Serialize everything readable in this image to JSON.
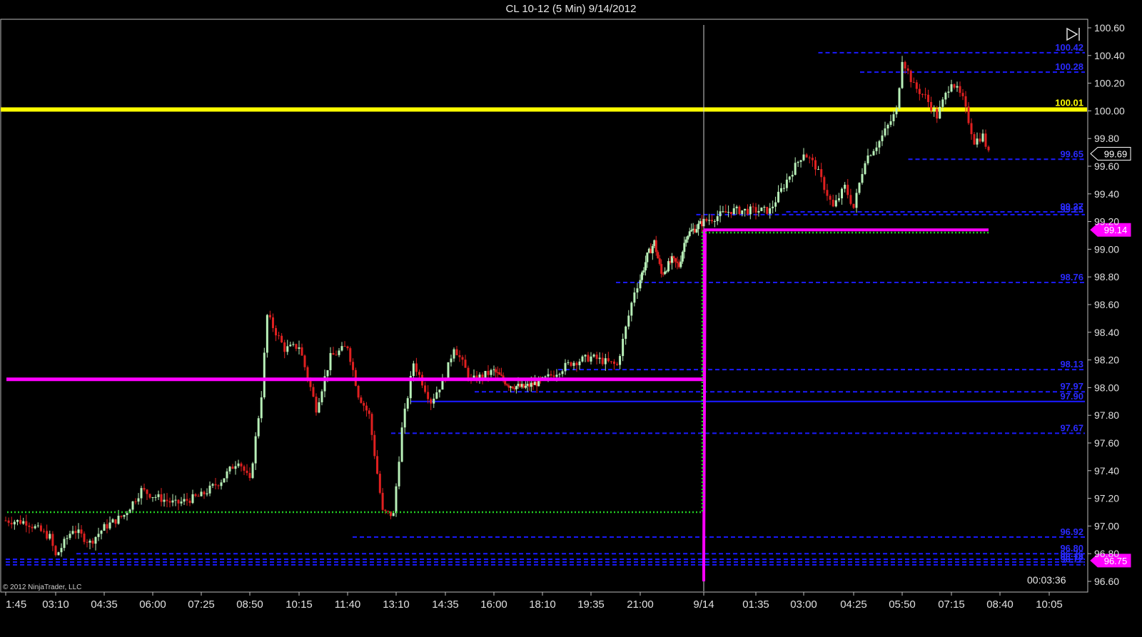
{
  "title": "CL 10-12 (5 Min)  9/14/2012",
  "copyright": "© 2012 NinjaTrader, LLC",
  "bar_timer": "00:03:36",
  "colors": {
    "background": "#000000",
    "up_bar": "#b8f0b8",
    "down_bar": "#e02020",
    "level_line": "#1a1aff",
    "level_label": "#2a2aff",
    "pivot": "#ffff00",
    "vwap": "#ff00ff",
    "dotted": "#22cc22",
    "price_tag": "#ffffff"
  },
  "chart_data": {
    "type": "line",
    "instrument": "CL 10-12",
    "interval": "5 Min",
    "ylim": [
      96.54,
      100.64
    ],
    "y_ticks": [
      "100.60",
      "100.40",
      "100.20",
      "100.00",
      "99.80",
      "99.60",
      "99.40",
      "99.20",
      "99.00",
      "98.80",
      "98.60",
      "98.40",
      "98.20",
      "98.00",
      "97.80",
      "97.60",
      "97.40",
      "97.20",
      "97.00",
      "96.80",
      "96.60"
    ],
    "x_ticks": [
      "1:45",
      "03:10",
      "04:35",
      "06:00",
      "07:25",
      "08:50",
      "10:15",
      "11:40",
      "13:10",
      "14:35",
      "16:00",
      "18:10",
      "19:35",
      "21:00",
      "9/14",
      "01:35",
      "03:00",
      "04:25",
      "05:50",
      "07:15",
      "08:40",
      "10:05"
    ],
    "price_path": [
      [
        "01:45",
        97.04
      ],
      [
        "02:20",
        97.03
      ],
      [
        "03:00",
        96.92
      ],
      [
        "03:10",
        96.78
      ],
      [
        "03:40",
        96.98
      ],
      [
        "04:10",
        96.88
      ],
      [
        "04:35",
        96.99
      ],
      [
        "05:10",
        97.08
      ],
      [
        "05:40",
        97.26
      ],
      [
        "06:00",
        97.22
      ],
      [
        "06:40",
        97.16
      ],
      [
        "07:25",
        97.22
      ],
      [
        "08:00",
        97.33
      ],
      [
        "08:30",
        97.48
      ],
      [
        "08:50",
        97.32
      ],
      [
        "09:10",
        97.95
      ],
      [
        "09:20",
        98.52
      ],
      [
        "09:50",
        98.28
      ],
      [
        "10:15",
        98.3
      ],
      [
        "10:45",
        97.85
      ],
      [
        "11:10",
        98.22
      ],
      [
        "11:40",
        98.3
      ],
      [
        "12:00",
        97.95
      ],
      [
        "12:20",
        97.8
      ],
      [
        "12:45",
        97.1
      ],
      [
        "13:05",
        97.08
      ],
      [
        "13:20",
        97.7
      ],
      [
        "13:40",
        98.18
      ],
      [
        "14:10",
        97.9
      ],
      [
        "14:35",
        98.08
      ],
      [
        "14:50",
        98.3
      ],
      [
        "15:20",
        98.05
      ],
      [
        "16:00",
        98.12
      ],
      [
        "16:40",
        98.02
      ],
      [
        "17:20",
        98.0
      ],
      [
        "18:10",
        98.05
      ],
      [
        "19:00",
        98.18
      ],
      [
        "19:35",
        98.22
      ],
      [
        "20:20",
        98.16
      ],
      [
        "20:50",
        98.7
      ],
      [
        "21:20",
        98.95
      ],
      [
        "21:40",
        99.05
      ],
      [
        "22:00",
        98.82
      ],
      [
        "22:30",
        98.92
      ],
      [
        "22:50",
        98.88
      ],
      [
        "23:10",
        99.1
      ],
      [
        "00:00",
        99.2
      ],
      [
        "00:50",
        99.28
      ],
      [
        "01:35",
        99.28
      ],
      [
        "02:00",
        99.28
      ],
      [
        "02:30",
        99.5
      ],
      [
        "03:00",
        99.7
      ],
      [
        "03:20",
        99.6
      ],
      [
        "03:50",
        99.3
      ],
      [
        "04:10",
        99.45
      ],
      [
        "04:25",
        99.3
      ],
      [
        "04:45",
        99.65
      ],
      [
        "05:10",
        99.78
      ],
      [
        "05:40",
        100.0
      ],
      [
        "05:50",
        100.38
      ],
      [
        "06:10",
        100.18
      ],
      [
        "06:30",
        100.1
      ],
      [
        "06:50",
        99.96
      ],
      [
        "07:15",
        100.22
      ],
      [
        "07:35",
        100.08
      ],
      [
        "07:55",
        99.78
      ],
      [
        "08:10",
        99.82
      ],
      [
        "08:20",
        99.69
      ]
    ],
    "last_price": "99.69",
    "vwap_tag": "99.14",
    "low_tag": "96.75",
    "pivot": {
      "value": 100.01,
      "label": "100.01"
    },
    "prev_vwap": 98.06,
    "prev_low_dotted": 97.1,
    "levels": [
      {
        "value": 100.42,
        "label": "100.42",
        "from_slot": 253
      },
      {
        "value": 100.28,
        "label": "100.28",
        "from_slot": 266
      },
      {
        "value": 99.65,
        "label": "99.65",
        "from_slot": 281
      },
      {
        "value": 99.27,
        "label": "99.27",
        "from_slot": 243
      },
      {
        "value": 99.25,
        "label": "99.25",
        "from_slot": 215
      },
      {
        "value": 98.76,
        "label": "98.76",
        "from_slot": 190
      },
      {
        "value": 98.13,
        "label": "98.13",
        "from_slot": 172
      },
      {
        "value": 97.97,
        "label": "97.97",
        "from_slot": 146
      },
      {
        "value": 97.9,
        "label": "97.90",
        "from_slot": 126,
        "solid": true
      },
      {
        "value": 97.67,
        "label": "97.67",
        "from_slot": 120
      },
      {
        "value": 96.92,
        "label": "96.92",
        "from_slot": 108
      },
      {
        "value": 96.8,
        "label": "96.80",
        "from_slot": 22
      },
      {
        "value": 96.76,
        "label": "96.76",
        "from_slot": 0
      },
      {
        "value": 96.74,
        "label": "96.74",
        "from_slot": 0
      },
      {
        "value": 96.72,
        "label": "96.72",
        "from_slot": 0
      }
    ]
  }
}
